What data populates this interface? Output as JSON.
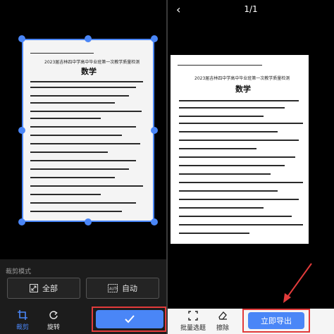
{
  "left": {
    "doc_heading_small": "2023届吉林四中学高中毕业班第一次教学质量检测",
    "doc_title": "数学",
    "mode_label": "裁剪模式",
    "modes": [
      {
        "icon": "expand-icon",
        "label": "全部"
      },
      {
        "icon": "auto-icon",
        "label": "自动"
      }
    ],
    "tools": [
      {
        "icon": "crop-icon",
        "label": "裁剪",
        "active": true
      },
      {
        "icon": "rotate-icon",
        "label": "旋转",
        "active": false
      }
    ],
    "confirm_icon": "checkmark-icon"
  },
  "right": {
    "page_counter": "1/1",
    "doc_heading_small": "2023届吉林四中学高中毕业班第一次教学质量检测",
    "doc_title": "数学",
    "tools": [
      {
        "icon": "batch-select-icon",
        "label": "批量选题"
      },
      {
        "icon": "eraser-icon",
        "label": "擦除"
      }
    ],
    "export_label": "立即导出"
  },
  "colors": {
    "accent": "#4a86f7",
    "highlight": "#e23b3b"
  }
}
